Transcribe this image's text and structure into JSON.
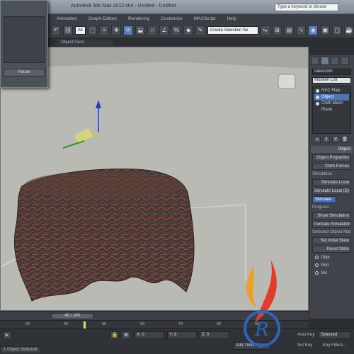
{
  "window": {
    "title": "Autodesk 3ds Max 2012 x64  -  Untitled - Untitled",
    "search_placeholder": "Type a keyword or phrase"
  },
  "menu": [
    "Animation",
    "Graph Editors",
    "Rendering",
    "Customize",
    "MAXScript",
    "Help"
  ],
  "toolbar": {
    "selection_filter": "All",
    "named_selection": "Create Selection Se"
  },
  "ribbon": {
    "label": "Object Paint"
  },
  "dialog": {
    "button_label": "Pause"
  },
  "viewport": {
    "background_color": "#a9aba6",
    "cloth_color": "#5a3d36"
  },
  "command_panel": {
    "object_name": "tablecloth",
    "modifier_list": "Modifier List",
    "stack": [
      {
        "label": "NVC Flap",
        "selected": false
      },
      {
        "label": "Object",
        "selected": true
      },
      {
        "label": "Cloth Mesh",
        "selected": false
      },
      {
        "label": "Plane",
        "selected": false
      }
    ],
    "rollout_title": "Object",
    "buttons": [
      "Object Properties",
      "Cloth Forces"
    ],
    "simulation_label": "Simulation",
    "sim_buttons": [
      "Simulate Local",
      "Simulate Local (D)"
    ],
    "simulate_label": "Simulate",
    "sim_options": [
      "Progress",
      "Show Simulation",
      "Truncate Simulation"
    ],
    "selected_label": "Selected Object Manip",
    "selected_buttons": [
      "Set Initial State",
      "Reset State"
    ],
    "radios": [
      "Obje",
      "Grid",
      "Sel"
    ]
  },
  "timeline": {
    "slider_label": "40 / 100",
    "ticks": [
      "30",
      "40",
      "50",
      "60",
      "70",
      "80",
      "90"
    ]
  },
  "statusbar": {
    "coord_x": "X:  0",
    "coord_y": "Y:  0",
    "coord_z": "Z:  0",
    "add_time_tag": "Add Time Tag",
    "auto_key": "Auto Key",
    "selected": "Selected",
    "key_filters": "Key Filters...",
    "set_key": "Set Key",
    "tabs": [
      "1 Object Selected"
    ]
  }
}
